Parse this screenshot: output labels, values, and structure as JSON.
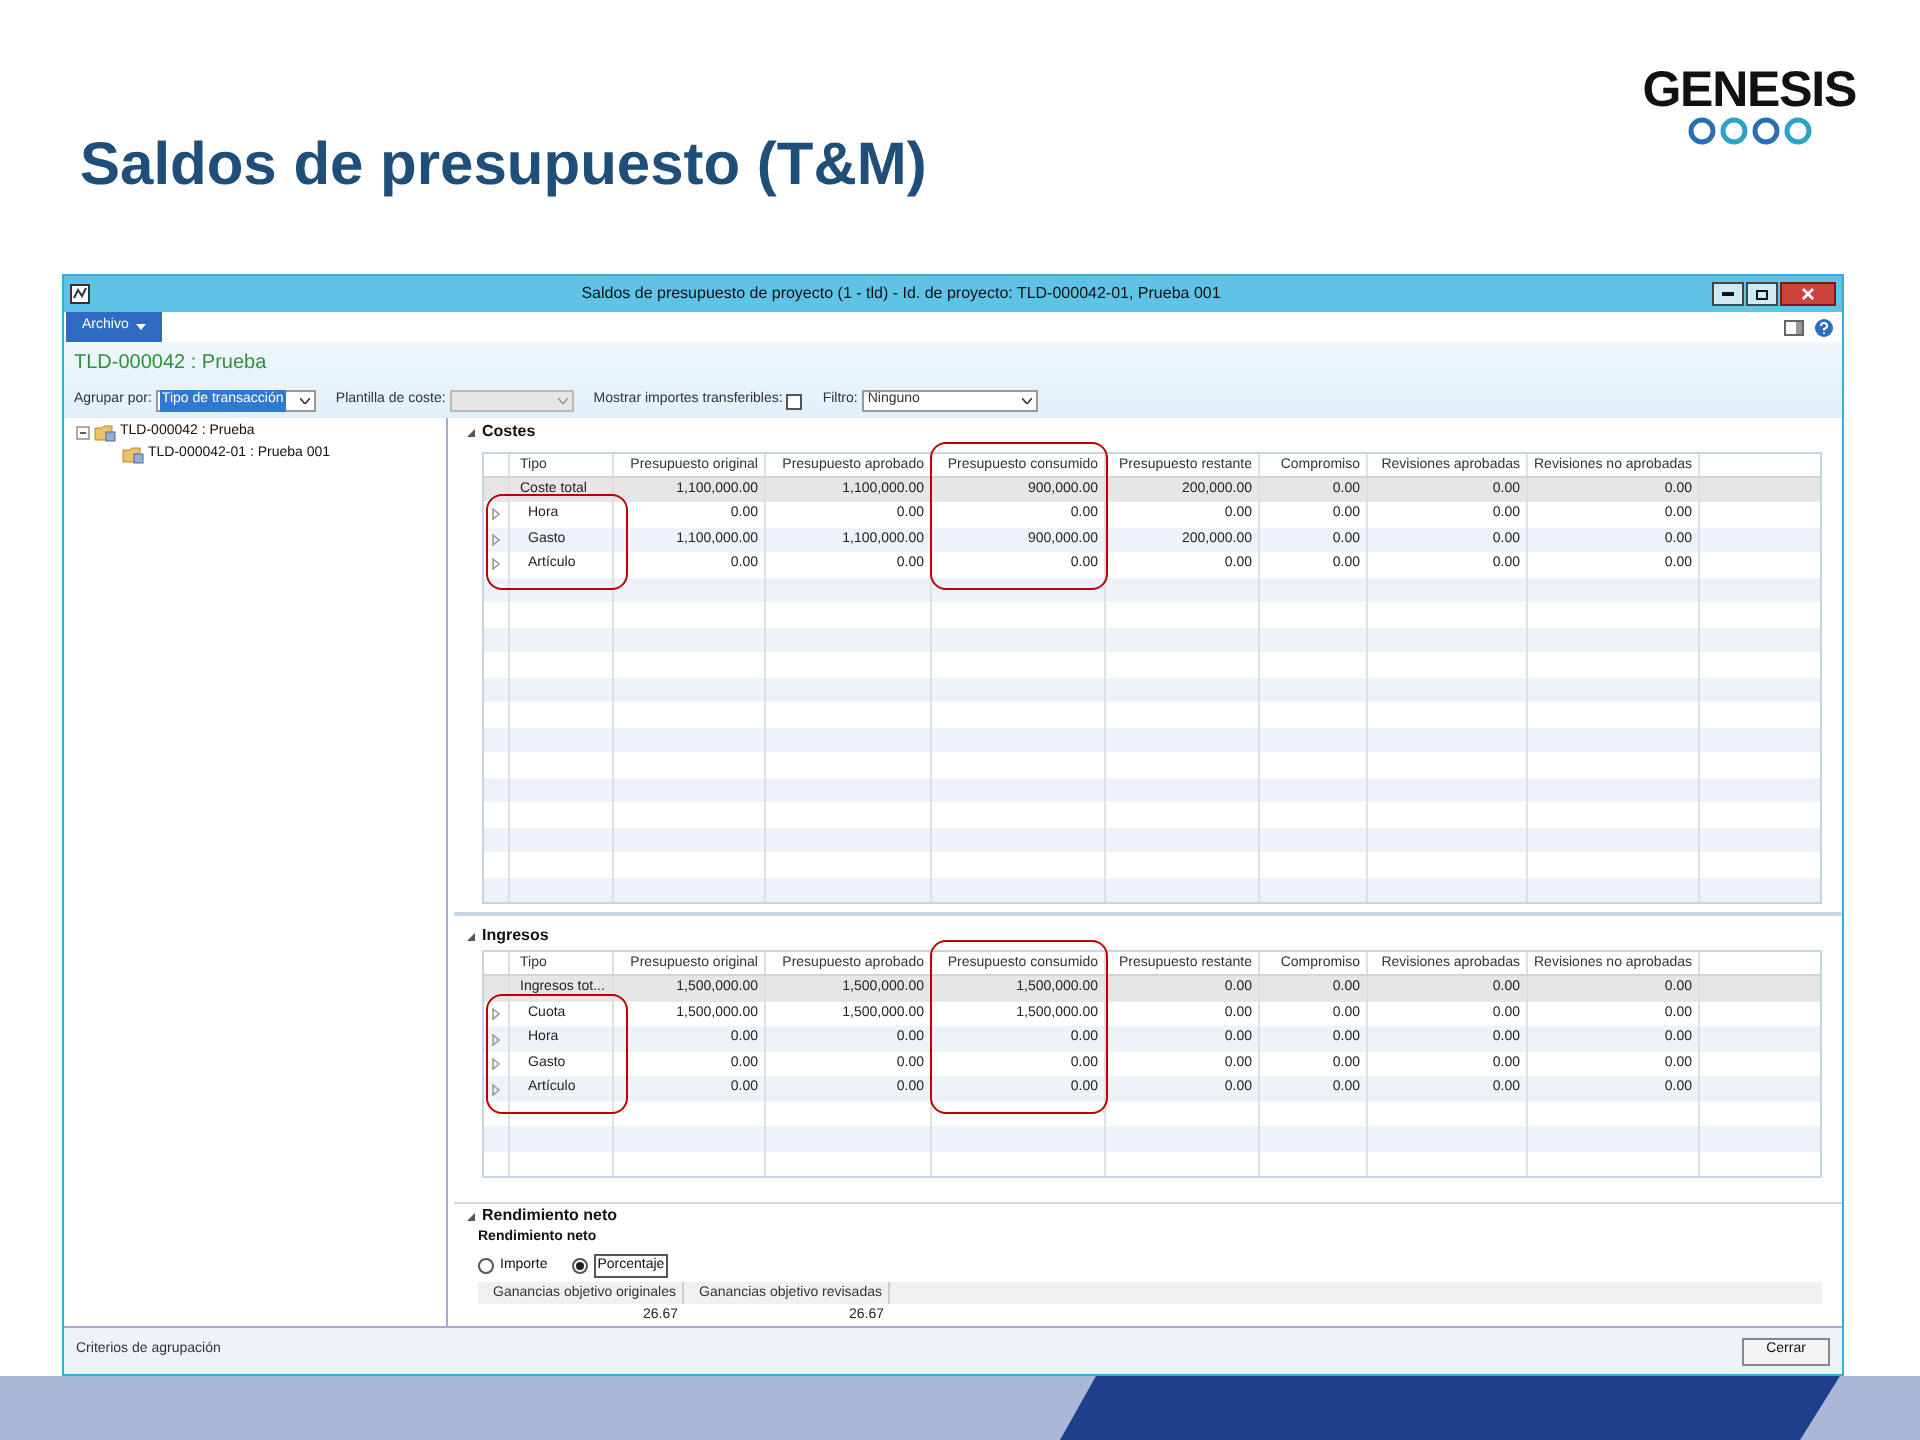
{
  "slide": {
    "title": "Saldos de presupuesto (T&M)",
    "logo_text": "GENESIS"
  },
  "window": {
    "title": "Saldos de presupuesto de proyecto (1 - tld) - Id. de proyecto: TLD-000042-01, Prueba 001",
    "menu": [
      {
        "label": "Archivo"
      }
    ],
    "header": "TLD-000042 : Prueba"
  },
  "filters": {
    "group_by": {
      "label": "Agrupar por:",
      "value": "Tipo de transacción"
    },
    "cost_template": {
      "label": "Plantilla de coste:"
    },
    "show_transferable": {
      "label": "Mostrar importes transferibles:",
      "checked": false
    },
    "filter": {
      "label": "Filtro:",
      "value": "Ninguno"
    }
  },
  "tree": [
    {
      "label": "TLD-000042 : Prueba",
      "expanded": true,
      "children": [
        {
          "label": "TLD-000042-01 : Prueba 001"
        }
      ]
    }
  ],
  "sections": [
    {
      "title": "Costes",
      "columns": [
        {
          "label": "Tipo",
          "highlighted": false
        },
        {
          "label": "Presupuesto original",
          "highlighted": false
        },
        {
          "label": "Presupuesto aprobado",
          "highlighted": false
        },
        {
          "label": "Presupuesto consumido",
          "highlighted": true
        },
        {
          "label": "Presupuesto restante",
          "highlighted": false
        },
        {
          "label": "Compromiso",
          "highlighted": false
        },
        {
          "label": "Revisiones aprobadas",
          "highlighted": false
        },
        {
          "label": "Revisiones no aprobadas",
          "highlighted": false
        }
      ],
      "rows": [
        {
          "kind": "total",
          "highlighted": false,
          "cells": [
            "Coste total",
            "1,100,000.00",
            "1,100,000.00",
            "900,000.00",
            "200,000.00",
            "0.00",
            "0.00",
            "0.00"
          ]
        },
        {
          "kind": "group",
          "highlighted": true,
          "cells": [
            "Hora",
            "0.00",
            "0.00",
            "0.00",
            "0.00",
            "0.00",
            "0.00",
            "0.00"
          ]
        },
        {
          "kind": "group",
          "highlighted": true,
          "cells": [
            "Gasto",
            "1,100,000.00",
            "1,100,000.00",
            "900,000.00",
            "200,000.00",
            "0.00",
            "0.00",
            "0.00"
          ]
        },
        {
          "kind": "group",
          "highlighted": true,
          "cells": [
            "Artículo",
            "0.00",
            "0.00",
            "0.00",
            "0.00",
            "0.00",
            "0.00",
            "0.00"
          ]
        }
      ]
    },
    {
      "title": "Ingresos",
      "columns": [
        {
          "label": "Tipo",
          "highlighted": false
        },
        {
          "label": "Presupuesto original",
          "highlighted": false
        },
        {
          "label": "Presupuesto aprobado",
          "highlighted": false
        },
        {
          "label": "Presupuesto consumido",
          "highlighted": true
        },
        {
          "label": "Presupuesto restante",
          "highlighted": false
        },
        {
          "label": "Compromiso",
          "highlighted": false
        },
        {
          "label": "Revisiones aprobadas",
          "highlighted": false
        },
        {
          "label": "Revisiones no aprobadas",
          "highlighted": false
        }
      ],
      "rows": [
        {
          "kind": "total",
          "highlighted": false,
          "cells": [
            "Ingresos tot...",
            "1,500,000.00",
            "1,500,000.00",
            "1,500,000.00",
            "0.00",
            "0.00",
            "0.00",
            "0.00"
          ]
        },
        {
          "kind": "group",
          "highlighted": true,
          "cells": [
            "Cuota",
            "1,500,000.00",
            "1,500,000.00",
            "1,500,000.00",
            "0.00",
            "0.00",
            "0.00",
            "0.00"
          ]
        },
        {
          "kind": "group",
          "highlighted": true,
          "cells": [
            "Hora",
            "0.00",
            "0.00",
            "0.00",
            "0.00",
            "0.00",
            "0.00",
            "0.00"
          ]
        },
        {
          "kind": "group",
          "highlighted": true,
          "cells": [
            "Gasto",
            "0.00",
            "0.00",
            "0.00",
            "0.00",
            "0.00",
            "0.00",
            "0.00"
          ]
        },
        {
          "kind": "group",
          "highlighted": true,
          "cells": [
            "Artículo",
            "0.00",
            "0.00",
            "0.00",
            "0.00",
            "0.00",
            "0.00",
            "0.00"
          ]
        }
      ]
    }
  ],
  "net_yield": {
    "title": "Rendimiento neto",
    "subtitle": "Rendimiento neto",
    "options": [
      {
        "label": "Importe",
        "selected": false
      },
      {
        "label": "Porcentaje",
        "selected": true
      }
    ],
    "columns": [
      "Ganancias objetivo originales",
      "Ganancias objetivo revisadas"
    ],
    "values": [
      "26.67",
      "26.67"
    ]
  },
  "status_bar": {
    "text": "Criterios de agrupación",
    "button": "Cerrar"
  }
}
